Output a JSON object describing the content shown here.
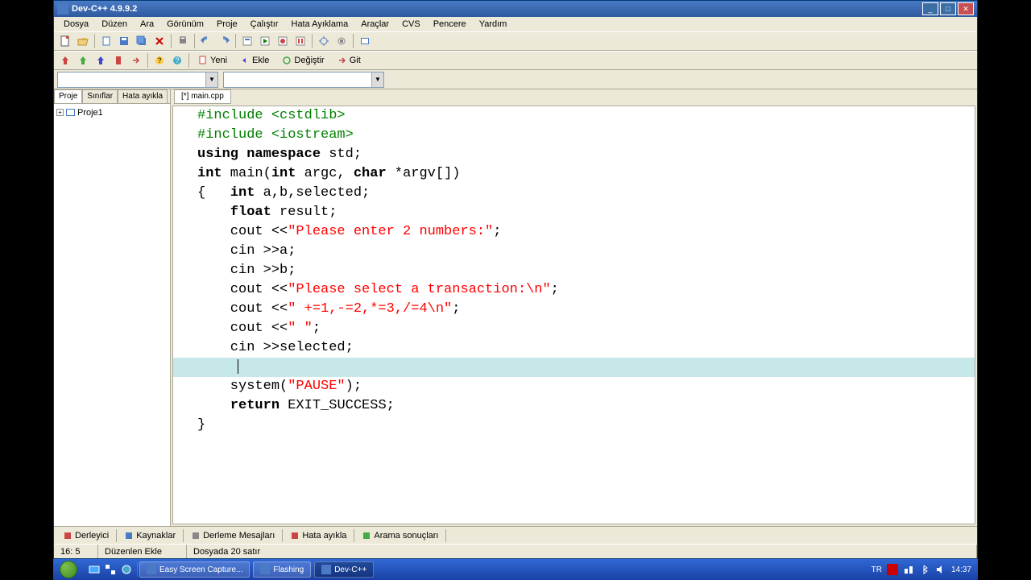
{
  "title": "Dev-C++ 4.9.9.2",
  "menu": [
    "Dosya",
    "Düzen",
    "Ara",
    "Görünüm",
    "Proje",
    "Çalıştır",
    "Hata Ayıklama",
    "Araçlar",
    "CVS",
    "Pencere",
    "Yardım"
  ],
  "toolbar2": {
    "yeni": "Yeni",
    "ekle": "Ekle",
    "degistir": "Değiştir",
    "git": "Git"
  },
  "left_tabs": [
    "Proje",
    "Sınıflar",
    "Hata ayıkla"
  ],
  "tree": {
    "root": "Proje1"
  },
  "file_tab": "[*] main.cpp",
  "code": {
    "lines": [
      {
        "t": "pp",
        "text": "#include <cstdlib>"
      },
      {
        "t": "pp",
        "text": "#include <iostream>"
      },
      {
        "t": "blank",
        "text": ""
      },
      {
        "t": "mix",
        "parts": [
          {
            "c": "kw",
            "v": "using namespace"
          },
          {
            "c": "",
            "v": " std;"
          }
        ]
      },
      {
        "t": "blank",
        "text": ""
      },
      {
        "t": "mix",
        "parts": [
          {
            "c": "kw",
            "v": "int"
          },
          {
            "c": "",
            "v": " main("
          },
          {
            "c": "kw",
            "v": "int"
          },
          {
            "c": "",
            "v": " argc, "
          },
          {
            "c": "kw",
            "v": "char"
          },
          {
            "c": "",
            "v": " *argv[])"
          }
        ]
      },
      {
        "t": "mix",
        "parts": [
          {
            "c": "",
            "v": "{   "
          },
          {
            "c": "kw",
            "v": "int"
          },
          {
            "c": "",
            "v": " a,b,selected;"
          }
        ]
      },
      {
        "t": "mix",
        "parts": [
          {
            "c": "",
            "v": "    "
          },
          {
            "c": "kw",
            "v": "float"
          },
          {
            "c": "",
            "v": " result;"
          }
        ]
      },
      {
        "t": "mix",
        "parts": [
          {
            "c": "",
            "v": "    cout <<"
          },
          {
            "c": "str",
            "v": "\"Please enter 2 numbers:\""
          },
          {
            "c": "",
            "v": ";"
          }
        ]
      },
      {
        "t": "plain",
        "text": "    cin >>a;"
      },
      {
        "t": "plain",
        "text": "    cin >>b;"
      },
      {
        "t": "mix",
        "parts": [
          {
            "c": "",
            "v": "    cout <<"
          },
          {
            "c": "str",
            "v": "\"Please select a transaction:\\n\""
          },
          {
            "c": "",
            "v": ";"
          }
        ]
      },
      {
        "t": "mix",
        "parts": [
          {
            "c": "",
            "v": "    cout <<"
          },
          {
            "c": "str",
            "v": "\" +=1,-=2,*=3,/=4\\n\""
          },
          {
            "c": "",
            "v": ";"
          }
        ]
      },
      {
        "t": "mix",
        "parts": [
          {
            "c": "",
            "v": "    cout <<"
          },
          {
            "c": "str",
            "v": "\" \""
          },
          {
            "c": "",
            "v": ";"
          }
        ]
      },
      {
        "t": "plain",
        "text": "    cin >>selected;"
      },
      {
        "t": "highlight",
        "text": "    "
      },
      {
        "t": "mix",
        "parts": [
          {
            "c": "",
            "v": "    system("
          },
          {
            "c": "str",
            "v": "\"PAUSE\""
          },
          {
            "c": "",
            "v": ");"
          }
        ]
      },
      {
        "t": "mix",
        "parts": [
          {
            "c": "",
            "v": "    "
          },
          {
            "c": "kw",
            "v": "return"
          },
          {
            "c": "",
            "v": " EXIT_SUCCESS;"
          }
        ]
      },
      {
        "t": "plain",
        "text": "}"
      }
    ]
  },
  "bottom_tabs": [
    "Derleyici",
    "Kaynaklar",
    "Derleme Mesajları",
    "Hata ayıkla",
    "Arama sonuçları"
  ],
  "status": {
    "pos": "16: 5",
    "mode": "Düzenlen Ekle",
    "file": "Dosyada 20 satır"
  },
  "taskbar": {
    "items": [
      "Easy Screen Capture...",
      "Flashing",
      "Dev-C++"
    ],
    "lang": "TR",
    "time": "14:37"
  }
}
